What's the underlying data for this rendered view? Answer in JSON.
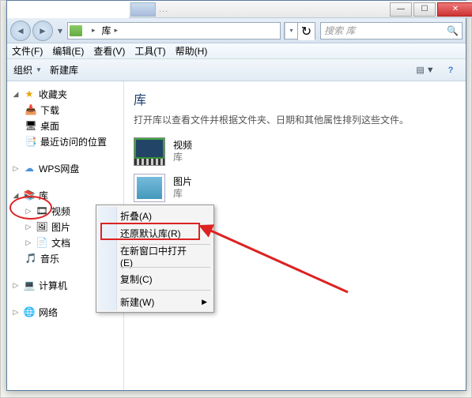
{
  "parent_window": {
    "title_placeholder": "..."
  },
  "win_buttons": {
    "min": "—",
    "max": "☐",
    "close": "✕"
  },
  "nav": {
    "back": "◄",
    "fwd": "►",
    "dd": "▾"
  },
  "address": {
    "root_label": "库",
    "chevron": "▸",
    "refresh": "↻",
    "dd": "▾"
  },
  "search": {
    "placeholder": "搜索 库",
    "icon": "🔍"
  },
  "menubar": [
    {
      "label": "文件(F)"
    },
    {
      "label": "编辑(E)"
    },
    {
      "label": "查看(V)"
    },
    {
      "label": "工具(T)"
    },
    {
      "label": "帮助(H)"
    }
  ],
  "toolbar": {
    "organize": "组织",
    "newlib": "新建库",
    "dd": "▼",
    "view_icon": "▤",
    "help_icon": "?"
  },
  "tree": {
    "fav": {
      "label": "收藏夹",
      "icon": "★",
      "color": "#e9a500"
    },
    "fav_items": [
      {
        "label": "下载",
        "icon": "📥"
      },
      {
        "label": "桌面",
        "icon": "🖥"
      },
      {
        "label": "最近访问的位置",
        "icon": "📑"
      }
    ],
    "wps": {
      "label": "WPS网盘",
      "icon": "☁",
      "color": "#4a90d9"
    },
    "lib": {
      "label": "库",
      "icon": "📚",
      "color": "#5a8"
    },
    "lib_items": [
      {
        "label": "视频",
        "icon": "🎞"
      },
      {
        "label": "图片",
        "icon": "🖼"
      },
      {
        "label": "文档",
        "icon": "📄"
      },
      {
        "label": "音乐",
        "icon": "🎵",
        "color": "#2a7"
      }
    ],
    "computer": {
      "label": "计算机",
      "icon": "💻"
    },
    "network": {
      "label": "网络",
      "icon": "🌐"
    }
  },
  "content": {
    "heading": "库",
    "desc": "打开库以查看文件并根据文件夹、日期和其他属性排列这些文件。",
    "items": [
      {
        "name": "视频",
        "sub": "库",
        "thumb": "video"
      },
      {
        "name": "图片",
        "sub": "库",
        "thumb": "pic"
      }
    ]
  },
  "context_menu": [
    {
      "label": "折叠(A)",
      "type": "item"
    },
    {
      "label": "还原默认库(R)",
      "type": "item",
      "highlighted": true
    },
    {
      "type": "sep"
    },
    {
      "label": "在新窗口中打开(E)",
      "type": "item"
    },
    {
      "type": "sep"
    },
    {
      "label": "复制(C)",
      "type": "item"
    },
    {
      "type": "sep"
    },
    {
      "label": "新建(W)",
      "type": "item",
      "submenu": true,
      "arrow": "▶"
    }
  ]
}
